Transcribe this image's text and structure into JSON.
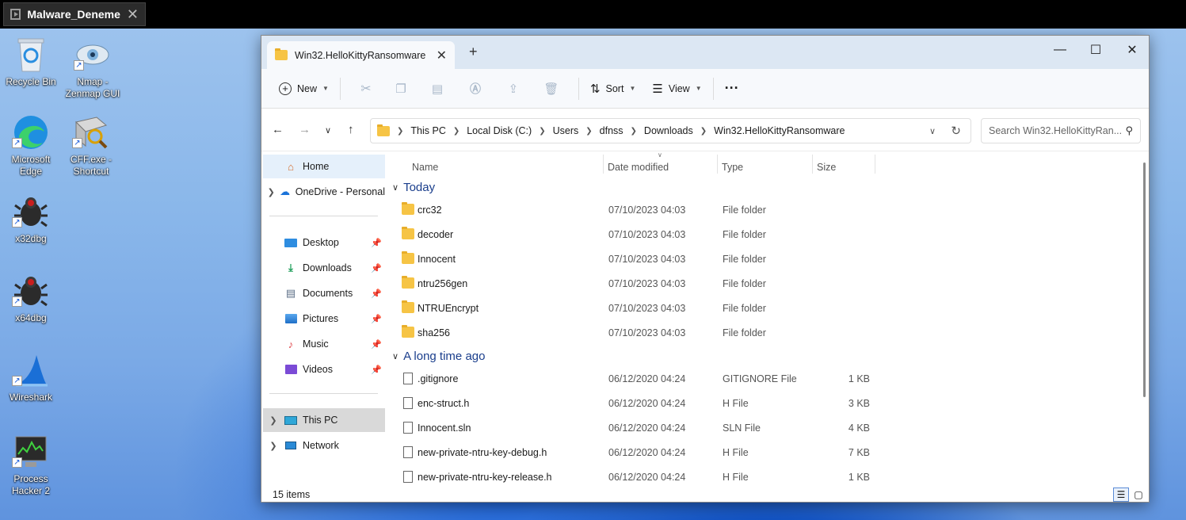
{
  "vm": {
    "tab_title": "Malware_Deneme"
  },
  "desktop": {
    "icons": [
      {
        "label": "Recycle Bin",
        "icon": "recycle-bin-icon"
      },
      {
        "label": "Nmap - Zenmap GUI",
        "icon": "nmap-eye-icon"
      },
      {
        "label": "Microsoft Edge",
        "icon": "edge-icon"
      },
      {
        "label": "CFF.exe - Shortcut",
        "icon": "cff-explorer-icon"
      },
      {
        "label": "x32dbg",
        "icon": "bug-icon"
      },
      {
        "label": "x64dbg",
        "icon": "bug-icon"
      },
      {
        "label": "Wireshark",
        "icon": "shark-fin-icon"
      },
      {
        "label": "Process Hacker 2",
        "icon": "process-monitor-icon"
      }
    ]
  },
  "explorer": {
    "tab_title": "Win32.HelloKittyRansomware",
    "toolbar": {
      "new_label": "New",
      "sort_label": "Sort",
      "view_label": "View"
    },
    "breadcrumb": [
      "This PC",
      "Local Disk (C:)",
      "Users",
      "dfnss",
      "Downloads",
      "Win32.HelloKittyRansomware"
    ],
    "search_placeholder": "Search Win32.HelloKittyRan...",
    "sidebar": {
      "home": "Home",
      "onedrive": "OneDrive - Personal",
      "quick": [
        "Desktop",
        "Downloads",
        "Documents",
        "Pictures",
        "Music",
        "Videos"
      ],
      "thispc": "This PC",
      "network": "Network"
    },
    "columns": {
      "name": "Name",
      "date": "Date modified",
      "type": "Type",
      "size": "Size"
    },
    "groups": [
      {
        "label": "Today",
        "files": [
          {
            "name": "crc32",
            "date": "07/10/2023 04:03",
            "type": "File folder",
            "size": "",
            "kind": "folder"
          },
          {
            "name": "decoder",
            "date": "07/10/2023 04:03",
            "type": "File folder",
            "size": "",
            "kind": "folder"
          },
          {
            "name": "Innocent",
            "date": "07/10/2023 04:03",
            "type": "File folder",
            "size": "",
            "kind": "folder"
          },
          {
            "name": "ntru256gen",
            "date": "07/10/2023 04:03",
            "type": "File folder",
            "size": "",
            "kind": "folder"
          },
          {
            "name": "NTRUEncrypt",
            "date": "07/10/2023 04:03",
            "type": "File folder",
            "size": "",
            "kind": "folder"
          },
          {
            "name": "sha256",
            "date": "07/10/2023 04:03",
            "type": "File folder",
            "size": "",
            "kind": "folder"
          }
        ]
      },
      {
        "label": "A long time ago",
        "files": [
          {
            "name": ".gitignore",
            "date": "06/12/2020 04:24",
            "type": "GITIGNORE File",
            "size": "1 KB",
            "kind": "file"
          },
          {
            "name": "enc-struct.h",
            "date": "06/12/2020 04:24",
            "type": "H File",
            "size": "3 KB",
            "kind": "file"
          },
          {
            "name": "Innocent.sln",
            "date": "06/12/2020 04:24",
            "type": "SLN File",
            "size": "4 KB",
            "kind": "file"
          },
          {
            "name": "new-private-ntru-key-debug.h",
            "date": "06/12/2020 04:24",
            "type": "H File",
            "size": "7 KB",
            "kind": "file"
          },
          {
            "name": "new-private-ntru-key-release.h",
            "date": "06/12/2020 04:24",
            "type": "H File",
            "size": "1 KB",
            "kind": "file"
          }
        ]
      }
    ],
    "status": {
      "item_count": "15 items"
    }
  }
}
